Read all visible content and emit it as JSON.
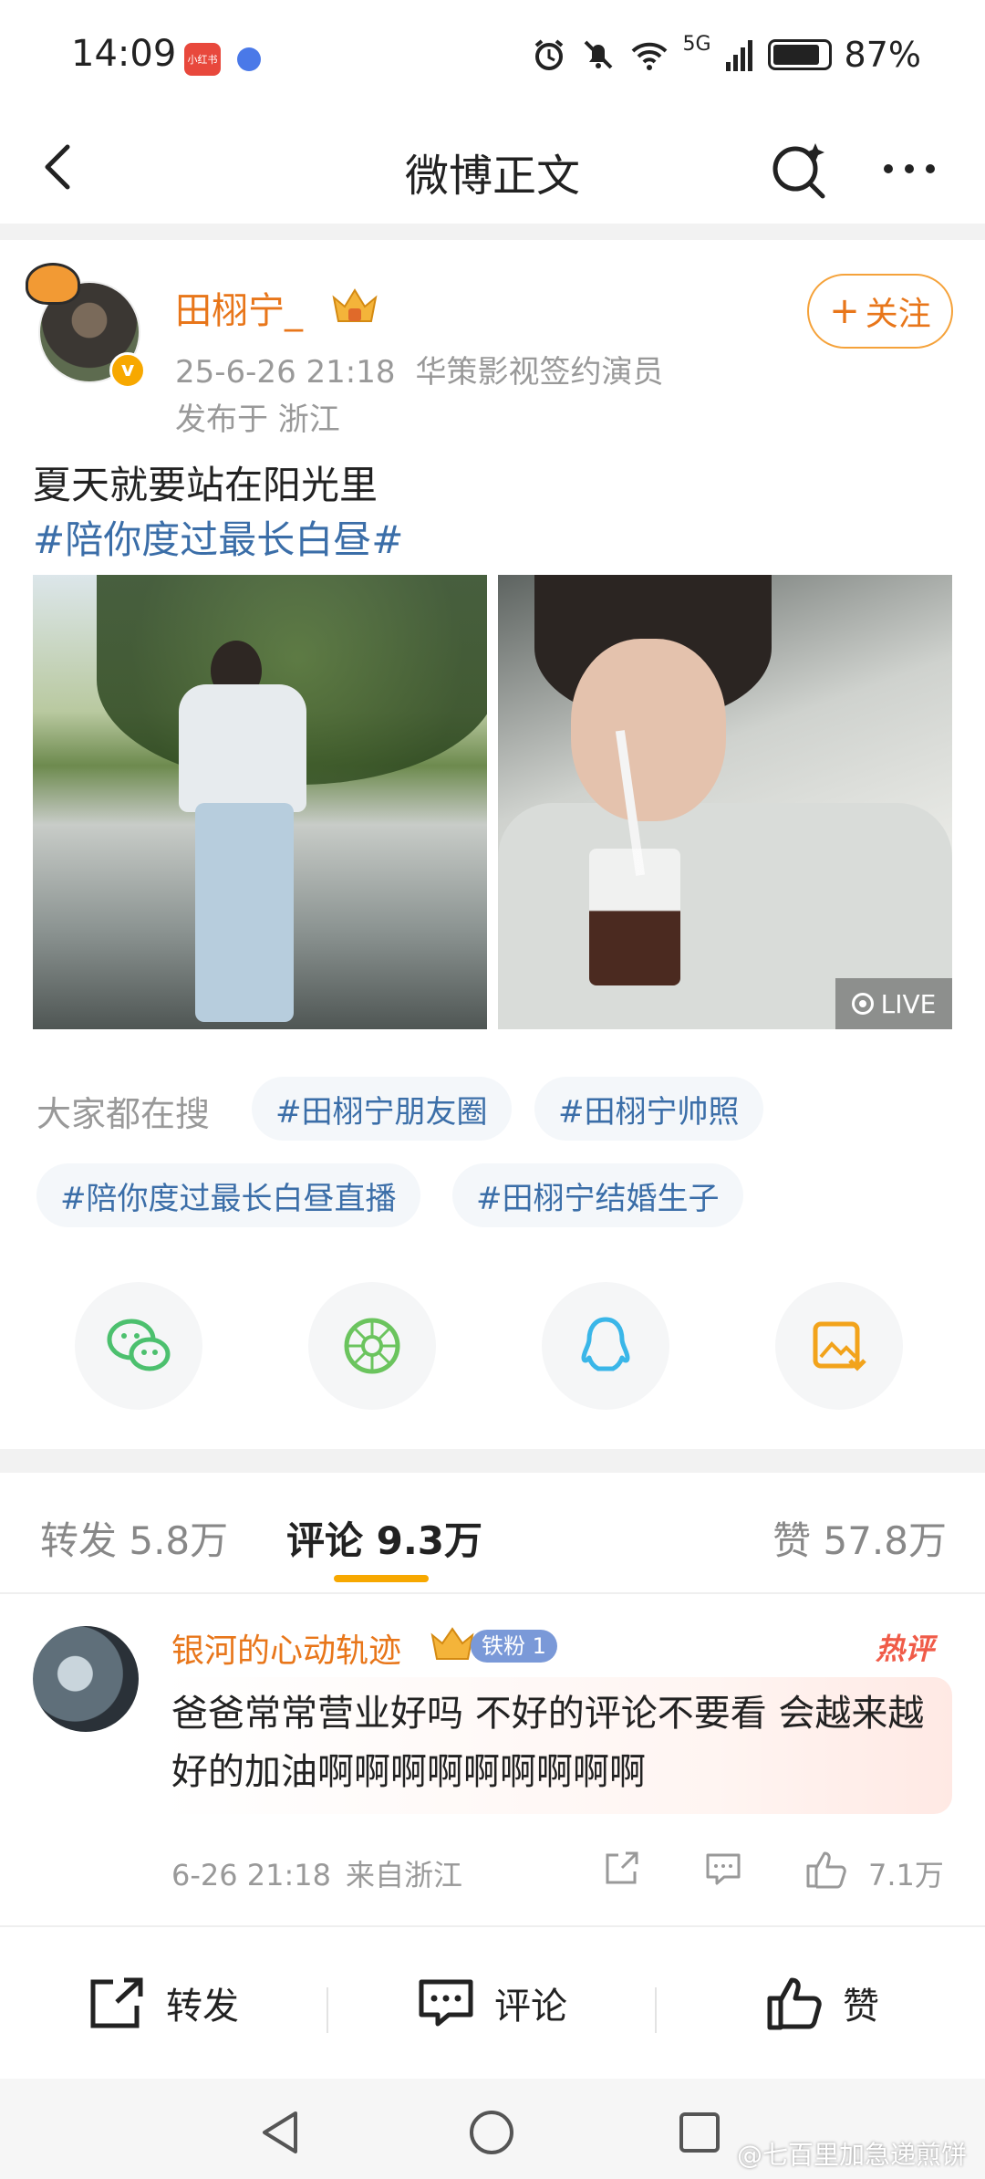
{
  "status_bar": {
    "time": "14:09",
    "app_badge": "小红书",
    "network": "5G",
    "battery": "87%",
    "battery_level": 0.87
  },
  "header": {
    "title": "微博正文"
  },
  "post": {
    "author": "田栩宁_",
    "date": "25-6-26 21:18",
    "role": "华策影视签约演员",
    "location": "发布于 浙江",
    "follow_label": "关注",
    "text": "夏天就要站在阳光里",
    "hashtag": "#陪你度过最长白昼#",
    "live_label": "LIVE"
  },
  "search": {
    "label": "大家都在搜",
    "chips": [
      "#田栩宁朋友圈",
      "#田栩宁帅照",
      "#陪你度过最长白昼直播",
      "#田栩宁结婚生子"
    ]
  },
  "share": {
    "icons": [
      "wechat-icon",
      "moments-icon",
      "qq-icon",
      "save-image-icon"
    ]
  },
  "tabs": {
    "repost": "转发 5.8万",
    "comment": "评论 9.3万",
    "like": "赞 57.8万"
  },
  "comment": {
    "user": "银河的心动轨迹",
    "fan_badge": "铁粉 1",
    "hot_label": "热评",
    "text": "爸爸常常营业好吗 不好的评论不要看 会越来越好的加油啊啊啊啊啊啊啊啊啊",
    "time": "6-26 21:18",
    "source": "来自浙江",
    "likes": "7.1万"
  },
  "actions": {
    "repost": "转发",
    "comment": "评论",
    "like": "赞"
  },
  "watermark": "@七百里加急递煎饼",
  "colors": {
    "accent": "#e8761a",
    "link": "#3b6ea8",
    "tab_indicator": "#f7a800",
    "hot": "#f05b48"
  }
}
